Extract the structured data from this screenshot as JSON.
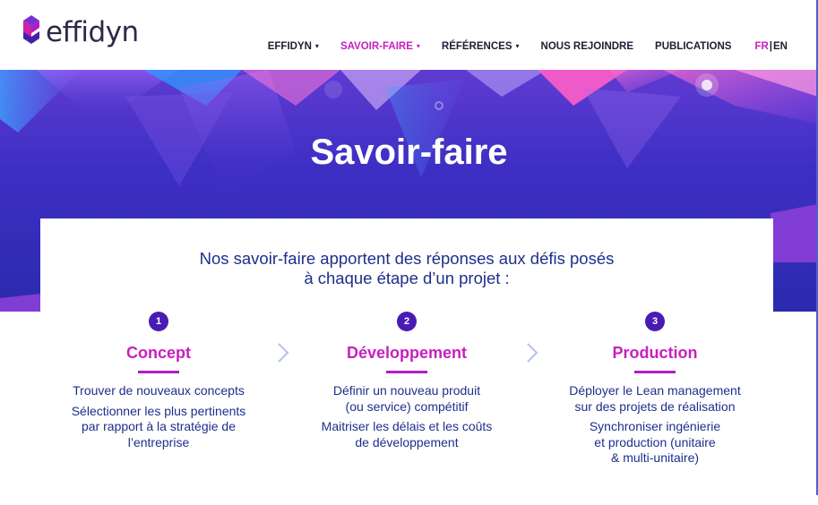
{
  "logo": {
    "text": "effidyn",
    "colors": [
      "#7a2ed6",
      "#d01fa5",
      "#3b1d8a"
    ]
  },
  "nav": {
    "items": [
      {
        "label": "EFFIDYN",
        "has_caret": true,
        "active": false
      },
      {
        "label": "SAVOIR-FAIRE",
        "has_caret": true,
        "active": true
      },
      {
        "label": "RÉFÉRENCES",
        "has_caret": true,
        "active": false
      },
      {
        "label": "NOUS REJOINDRE",
        "has_caret": false,
        "active": false
      },
      {
        "label": "PUBLICATIONS",
        "has_caret": false,
        "active": false
      }
    ],
    "caret_glyph": "▾",
    "lang": {
      "fr": "FR",
      "separator": "|",
      "en": "EN"
    }
  },
  "hero": {
    "title": "Savoir-faire"
  },
  "intro": {
    "line1": "Nos savoir-faire apportent des réponses aux défis posés",
    "line2": "à chaque étape d’un projet :"
  },
  "steps": [
    {
      "number": "1",
      "title": "Concept",
      "paragraphs": [
        [
          "Trouver de nouveaux concepts"
        ],
        [
          "Sélectionner les plus pertinents",
          "par rapport à la stratégie de",
          "l’entreprise"
        ]
      ]
    },
    {
      "number": "2",
      "title": "Développement",
      "paragraphs": [
        [
          "Définir un nouveau produit",
          "(ou service) compétitif"
        ],
        [
          "Maitriser les délais et les coûts",
          "de développement"
        ]
      ]
    },
    {
      "number": "3",
      "title": "Production",
      "paragraphs": [
        [
          "Déployer le Lean management",
          "sur des projets de réalisation"
        ],
        [
          "Synchroniser ingénierie",
          "et production (unitaire",
          "& multi-unitaire)"
        ]
      ]
    }
  ],
  "icons": {
    "step_separator": "chevron-right-icon"
  },
  "colors": {
    "accent": "#c81fbf",
    "navy_text": "#1d2f8a",
    "step_badge": "#4a1bb3",
    "hero_top": "#5f3bd1",
    "hero_bottom": "#2b2aae"
  }
}
